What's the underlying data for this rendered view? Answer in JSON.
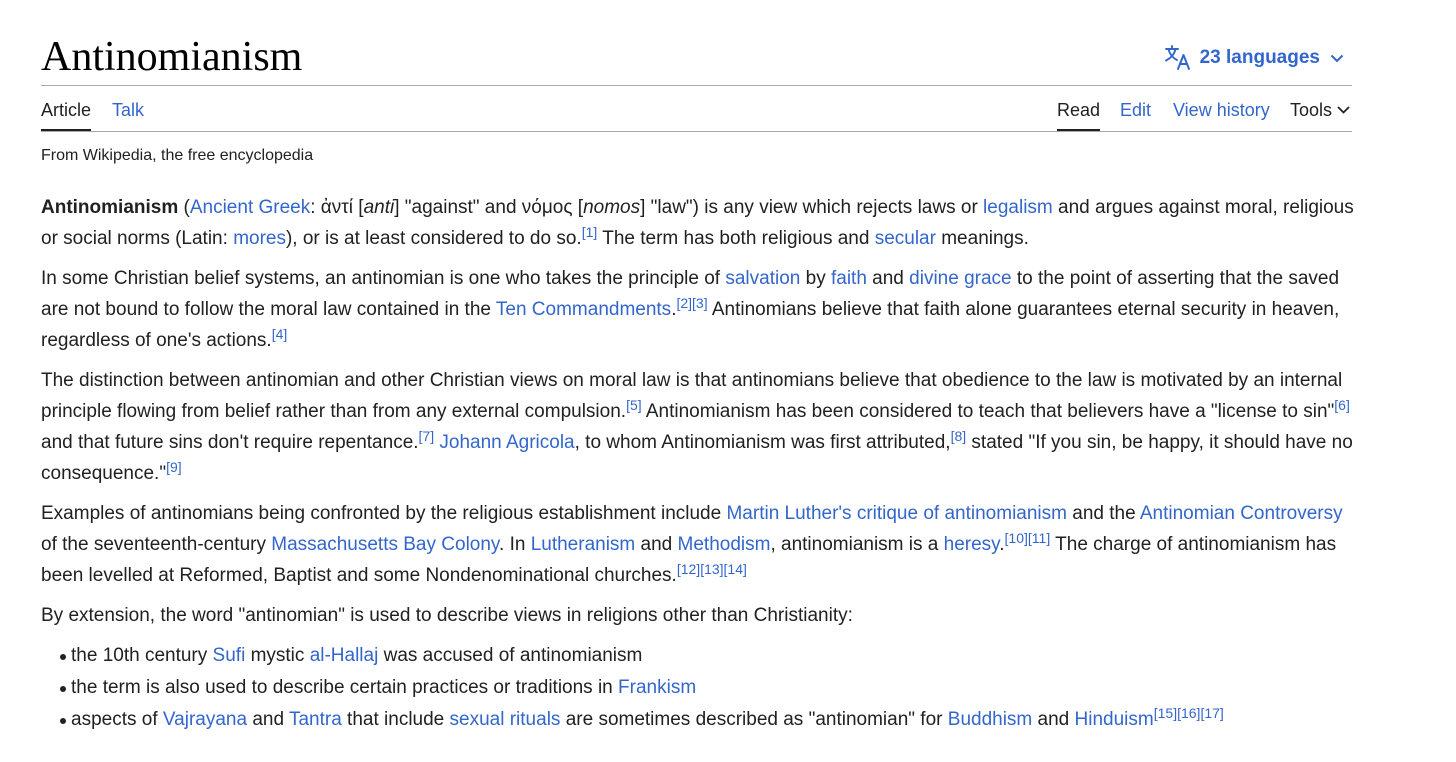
{
  "header": {
    "title": "Antinomianism",
    "languages_label": "23 languages"
  },
  "tabs": {
    "article": "Article",
    "talk": "Talk",
    "read": "Read",
    "edit": "Edit",
    "view_history": "View history",
    "tools": "Tools"
  },
  "tagline": "From Wikipedia, the free encyclopedia",
  "refs": {
    "r1": "[1]",
    "r2": "[2]",
    "r3": "[3]",
    "r4": "[4]",
    "r5": "[5]",
    "r6": "[6]",
    "r7": "[7]",
    "r8": "[8]",
    "r9": "[9]",
    "r10": "[10]",
    "r11": "[11]",
    "r12": "[12]",
    "r13": "[13]",
    "r14": "[14]",
    "r15": "[15]",
    "r16": "[16]",
    "r17": "[17]"
  },
  "p1": {
    "bold": "Antinomianism",
    "t1": " (",
    "link_greek": "Ancient Greek",
    "t2": ": ἀντί [",
    "anti": "anti",
    "t3": "] \"against\" and νόμος [",
    "nomos": "nomos",
    "t4": "] \"law\") is any view which rejects laws or ",
    "link_legalism": "legalism",
    "t5": " and argues against moral, religious or social norms (Latin: ",
    "link_mores": "mores",
    "t6": "), or is at least considered to do so.",
    "t7": " The term has both religious and ",
    "link_secular": "secular",
    "t8": " meanings."
  },
  "p2": {
    "t1": "In some Christian belief systems, an antinomian is one who takes the principle of ",
    "link_salvation": "salvation",
    "t2": " by ",
    "link_faith": "faith",
    "t3": " and ",
    "link_divine_grace": "divine grace",
    "t4": " to the point of asserting that the saved are not bound to follow the moral law contained in the ",
    "link_ten_commandments": "Ten Commandments",
    "t5": ".",
    "t6": " Antinomians believe that faith alone guarantees eternal security in heaven, regardless of one's actions."
  },
  "p3": {
    "t1": "The distinction between antinomian and other Christian views on moral law is that antinomians believe that obedience to the law is motivated by an internal principle flowing from belief rather than from any external compulsion.",
    "t2": " Antinomianism has been considered to teach that believers have a \"license to sin\"",
    "t3": " and that future sins don't require repentance.",
    "t4": " ",
    "link_agricola": "Johann Agricola",
    "t5": ", to whom Antinomianism was first attributed,",
    "t6": " stated \"If you sin, be happy, it should have no consequence.\""
  },
  "p4": {
    "t1": "Examples of antinomians being confronted by the religious establishment include ",
    "link_luther": "Martin Luther's critique of antinomianism",
    "t2": " and the ",
    "link_controversy": "Antinomian Controversy",
    "t3": " of the seventeenth-century ",
    "link_massachusetts": "Massachusetts Bay Colony",
    "t4": ". In ",
    "link_lutheranism": "Lutheranism",
    "t5": " and ",
    "link_methodism": "Methodism",
    "t6": ", antinomianism is a ",
    "link_heresy": "heresy",
    "t7": ".",
    "t8": " The charge of antinomianism has been levelled at Reformed, Baptist and some Nondenominational churches."
  },
  "p5": {
    "t1": "By extension, the word \"antinomian\" is used to describe views in religions other than Christianity:"
  },
  "list": {
    "i1_t1": "the 10th century ",
    "i1_sufi": "Sufi",
    "i1_t2": " mystic ",
    "i1_hallaj": "al-Hallaj",
    "i1_t3": " was accused of antinomianism",
    "i2_t1": "the term is also used to describe certain practices or traditions in ",
    "i2_frankism": "Frankism",
    "i3_t1": "aspects of ",
    "i3_vajrayana": "Vajrayana",
    "i3_t2": " and ",
    "i3_tantra": "Tantra",
    "i3_t3": " that include ",
    "i3_sexual": "sexual rituals",
    "i3_t4": " are sometimes described as \"antinomian\" for ",
    "i3_buddhism": "Buddhism",
    "i3_t5": " and ",
    "i3_hinduism": "Hinduism"
  },
  "colors": {
    "link": "#3366cc",
    "text": "#202122",
    "border": "#a2a9b1"
  }
}
